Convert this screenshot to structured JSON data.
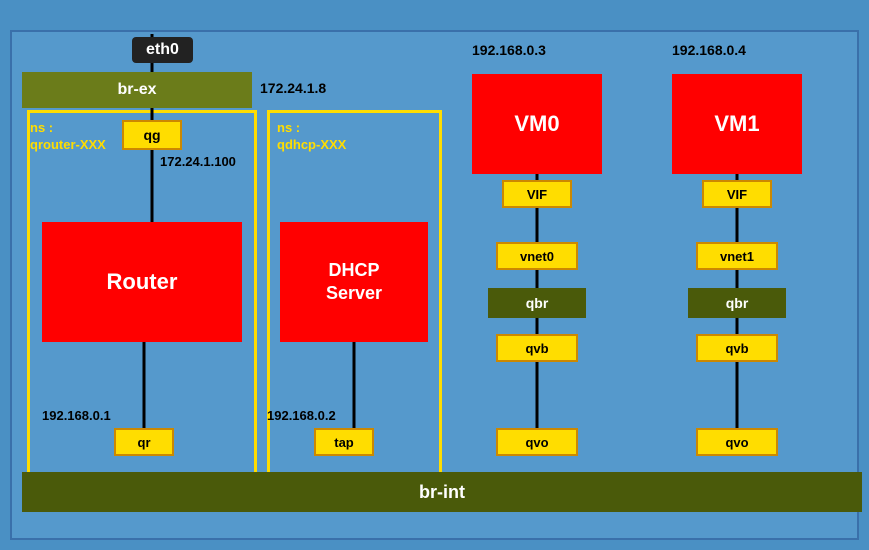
{
  "eth0": "eth0",
  "br_ex": "br-ex",
  "br_int": "br-int",
  "ip_172_8": "172.24.1.8",
  "ip_172_100": "172.24.1.100",
  "ip_192_01": "192.168.0.1",
  "ip_192_02": "192.168.0.2",
  "ip_192_03": "192.168.0.3",
  "ip_192_04": "192.168.0.4",
  "ns_qrouter": "ns :\nqrouter-XXX",
  "ns_qdhcp": "ns :\nqdhcp-XXX",
  "qg": "qg",
  "qr": "qr",
  "tap": "tap",
  "router": "Router",
  "dhcp_server": "DHCP\nServer",
  "vm0": "VM0",
  "vm1": "VM1",
  "vif": "VIF",
  "vnet0": "vnet0",
  "vnet1": "vnet1",
  "qbr": "qbr",
  "qvb": "qvb",
  "qvo": "qvo"
}
